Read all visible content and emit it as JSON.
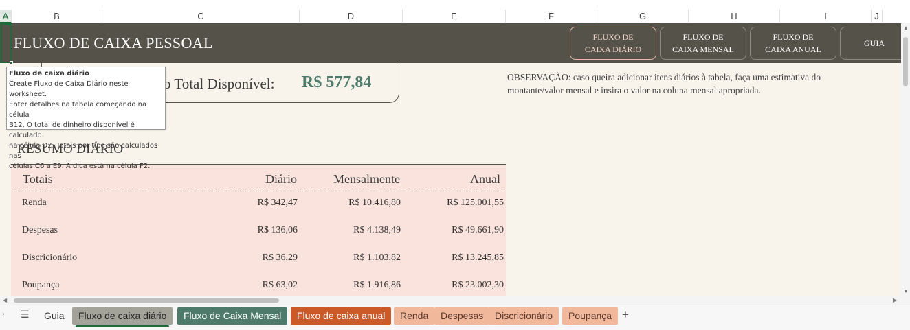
{
  "columns": [
    {
      "id": "A",
      "selected": true
    },
    {
      "id": "B"
    },
    {
      "id": "C"
    },
    {
      "id": "D"
    },
    {
      "id": "E"
    },
    {
      "id": "F"
    },
    {
      "id": "G"
    },
    {
      "id": "H"
    },
    {
      "id": "I"
    },
    {
      "id": "J"
    }
  ],
  "banner": {
    "title": "FLUXO DE CAIXA PESSOAL",
    "nav_buttons": [
      {
        "line1": "FLUXO DE",
        "line2": "CAIXA DIÁRIO",
        "active": true
      },
      {
        "line1": "FLUXO DE",
        "line2": "CAIXA MENSAL"
      },
      {
        "line1": "FLUXO DE",
        "line2": "CAIXA ANUAL"
      },
      {
        "line1": "GUIA",
        "line2": ""
      }
    ]
  },
  "total": {
    "label": "ro Total Disponível:",
    "value": "R$ 577,84"
  },
  "note": "OBSERVAÇÃO: caso queira adicionar itens diários à tabela, faça uma estimativa do montante/valor mensal e insira o valor na coluna mensal apropriada.",
  "tooltip": {
    "title": "Fluxo de caixa diário",
    "lines": [
      "Create Fluxo de Caixa Diário neste worksheet.",
      "Enter detalhes na tabela começando na célula",
      "B12. O total de dinheiro disponível é calculado",
      "na célula D2. Totais por tipo são calculados nas",
      "células C6 a E9. A dica está na célula F2."
    ]
  },
  "summary": {
    "title": "RESUMO DIÁRIO",
    "headers": [
      "Totais",
      "Diário",
      "Mensalmente",
      "Anual"
    ],
    "rows": [
      {
        "label": "Renda",
        "daily": "R$ 342,47",
        "monthly": "R$ 10.416,80",
        "annual": "R$ 125.001,55"
      },
      {
        "label": "Despesas",
        "daily": "R$ 136,06",
        "monthly": "R$ 4.138,49",
        "annual": "R$ 49.661,90"
      },
      {
        "label": "Discricionário",
        "daily": "R$ 36,29",
        "monthly": "R$ 1.103,82",
        "annual": "R$ 13.245,85"
      },
      {
        "label": "Poupança",
        "daily": "R$ 63,02",
        "monthly": "R$ 1.916,86",
        "annual": "R$ 23.002,30"
      }
    ]
  },
  "tabs": [
    {
      "label": "Guia",
      "style": "plain"
    },
    {
      "label": "Fluxo de caixa diário",
      "style": "active",
      "bg": "#a4a39a"
    },
    {
      "label": "Fluxo de Caixa Mensal",
      "bg": "#4e7a6c",
      "fg": "#ffffff"
    },
    {
      "label": "Fluxo de caixa anual",
      "bg": "#cc5a29",
      "fg": "#ffffff"
    },
    {
      "label": "Renda",
      "bg": "#f2b89c",
      "fg": "#5a3a2e"
    },
    {
      "label": "Despesas",
      "bg": "#f2b89c",
      "fg": "#5a3a2e"
    },
    {
      "label": "Discricionário",
      "bg": "#f2b89c",
      "fg": "#5a3a2e"
    },
    {
      "label": "Poupança",
      "bg": "#f2b89c",
      "fg": "#5a3a2e"
    }
  ],
  "icons": {
    "menu": "hamburger-icon",
    "add": "plus-icon",
    "prev": "chevron-left-icon"
  },
  "colors": {
    "banner": "#545249",
    "table_bg": "#f9e3dc",
    "accent_green": "#4e7a6c",
    "selection": "#1e6b3a"
  }
}
